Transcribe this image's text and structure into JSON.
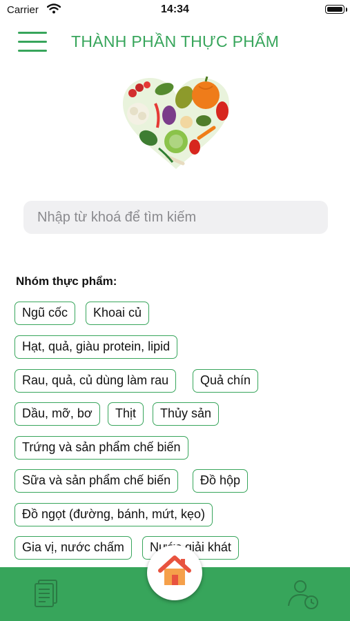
{
  "status_bar": {
    "carrier": "Carrier",
    "time": "14:34"
  },
  "header": {
    "title": "THÀNH PHẦN THỰC PHẨM",
    "menu_icon": "hamburger-menu-icon"
  },
  "hero": {
    "image": "vegetable-heart-illustration"
  },
  "search": {
    "placeholder": "Nhập từ khoá để tìm kiếm",
    "value": ""
  },
  "food_groups": {
    "heading": "Nhóm thực phẩm:",
    "items": [
      "Ngũ cốc",
      "Khoai củ",
      "Hạt, quả, giàu protein, lipid",
      "Rau, quả, củ dùng làm rau",
      "Quả chín",
      "Dầu, mỡ, bơ",
      "Thịt",
      "Thủy sản",
      "Trứng và sản phẩm chế biến",
      "Sữa và sản phẩm chế biến",
      "Đồ hộp",
      "Đồ ngọt (đường, bánh, mứt, kẹo)",
      "Gia vị, nước chấm",
      "Nước giải khát"
    ]
  },
  "bottom_nav": {
    "left_icon": "document-list-icon",
    "center_icon": "home-icon",
    "right_icon": "user-history-icon"
  },
  "colors": {
    "primary": "#37a55b",
    "search_bg": "#f0f0f2"
  }
}
